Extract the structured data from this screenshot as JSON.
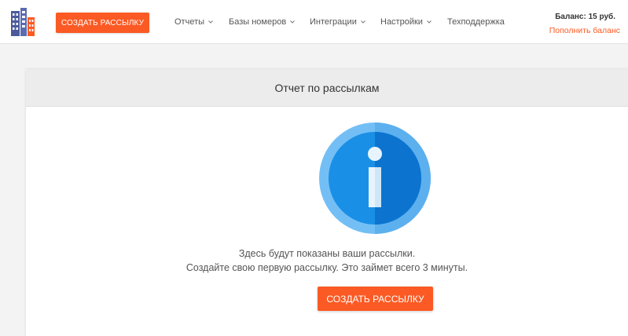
{
  "header": {
    "create_button_label": "СОЗДАТЬ РАССЫЛКУ",
    "nav": [
      {
        "label": "Отчеты",
        "has_dropdown": true,
        "icon": "chevron-down-icon"
      },
      {
        "label": "Базы номеров",
        "has_dropdown": true,
        "icon": "chevron-down-icon"
      },
      {
        "label": "Интеграции",
        "has_dropdown": true,
        "icon": "chevron-down-icon"
      },
      {
        "label": "Настройки",
        "has_dropdown": true,
        "icon": "chevron-down-icon"
      },
      {
        "label": "Техподдержка",
        "has_dropdown": false
      }
    ],
    "balance_label": "Баланс: 15 руб.",
    "topup_link": "Пополнить баланс"
  },
  "main": {
    "panel_title": "Отчет по рассылкам",
    "icon": "info-icon",
    "message_line1": "Здесь будут показаны ваши рассылки.",
    "message_line2": "Создайте свою первую рассылку. Это займет всего 3 минуты.",
    "create_button_label": "СОЗДАТЬ РАССЫЛКУ"
  },
  "colors": {
    "accent": "#fb5a24",
    "info_outer": "#64b5f6",
    "info_inner": "#1e88e5",
    "background": "#f3f3f3"
  }
}
